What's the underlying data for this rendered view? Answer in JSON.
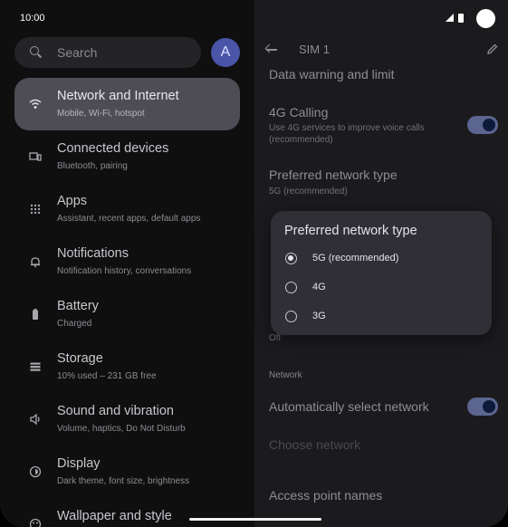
{
  "status": {
    "time": "10:00"
  },
  "search": {
    "placeholder": "Search"
  },
  "avatar": {
    "letter": "A"
  },
  "nav": [
    {
      "title": "Network and Internet",
      "sub": "Mobile, Wi-Fi, hotspot",
      "icon": "wifi-icon",
      "selected": true
    },
    {
      "title": "Connected devices",
      "sub": "Bluetooth, pairing",
      "icon": "devices-icon"
    },
    {
      "title": "Apps",
      "sub": "Assistant, recent apps, default apps",
      "icon": "apps-icon"
    },
    {
      "title": "Notifications",
      "sub": "Notification history, conversations",
      "icon": "bell-icon"
    },
    {
      "title": "Battery",
      "sub": "Charged",
      "icon": "battery-icon"
    },
    {
      "title": "Storage",
      "sub": "10% used – 231 GB free",
      "icon": "storage-icon"
    },
    {
      "title": "Sound and vibration",
      "sub": "Volume, haptics, Do Not Disturb",
      "icon": "volume-icon"
    },
    {
      "title": "Display",
      "sub": "Dark theme, font size, brightness",
      "icon": "display-icon"
    },
    {
      "title": "Wallpaper and style",
      "sub": "",
      "icon": "palette-icon"
    }
  ],
  "detail": {
    "title": "SIM 1",
    "data_warning": "Data warning and limit",
    "calling_title": "4G Calling",
    "calling_sub": "Use 4G services to improve voice calls (recommended)",
    "pref_title": "Preferred network type",
    "pref_sub": "5G (recommended)",
    "off_text": "Off",
    "section_network": "Network",
    "auto_select": "Automatically select network",
    "choose_network": "Choose network",
    "apn": "Access point names"
  },
  "dialog": {
    "title": "Preferred network type",
    "options": [
      "5G (recommended)",
      "4G",
      "3G"
    ],
    "selected_index": 0
  },
  "colors": {
    "accent_toggle": "#5b6590",
    "selected_nav": "#4e4d55",
    "avatar": "#4a55a8"
  }
}
